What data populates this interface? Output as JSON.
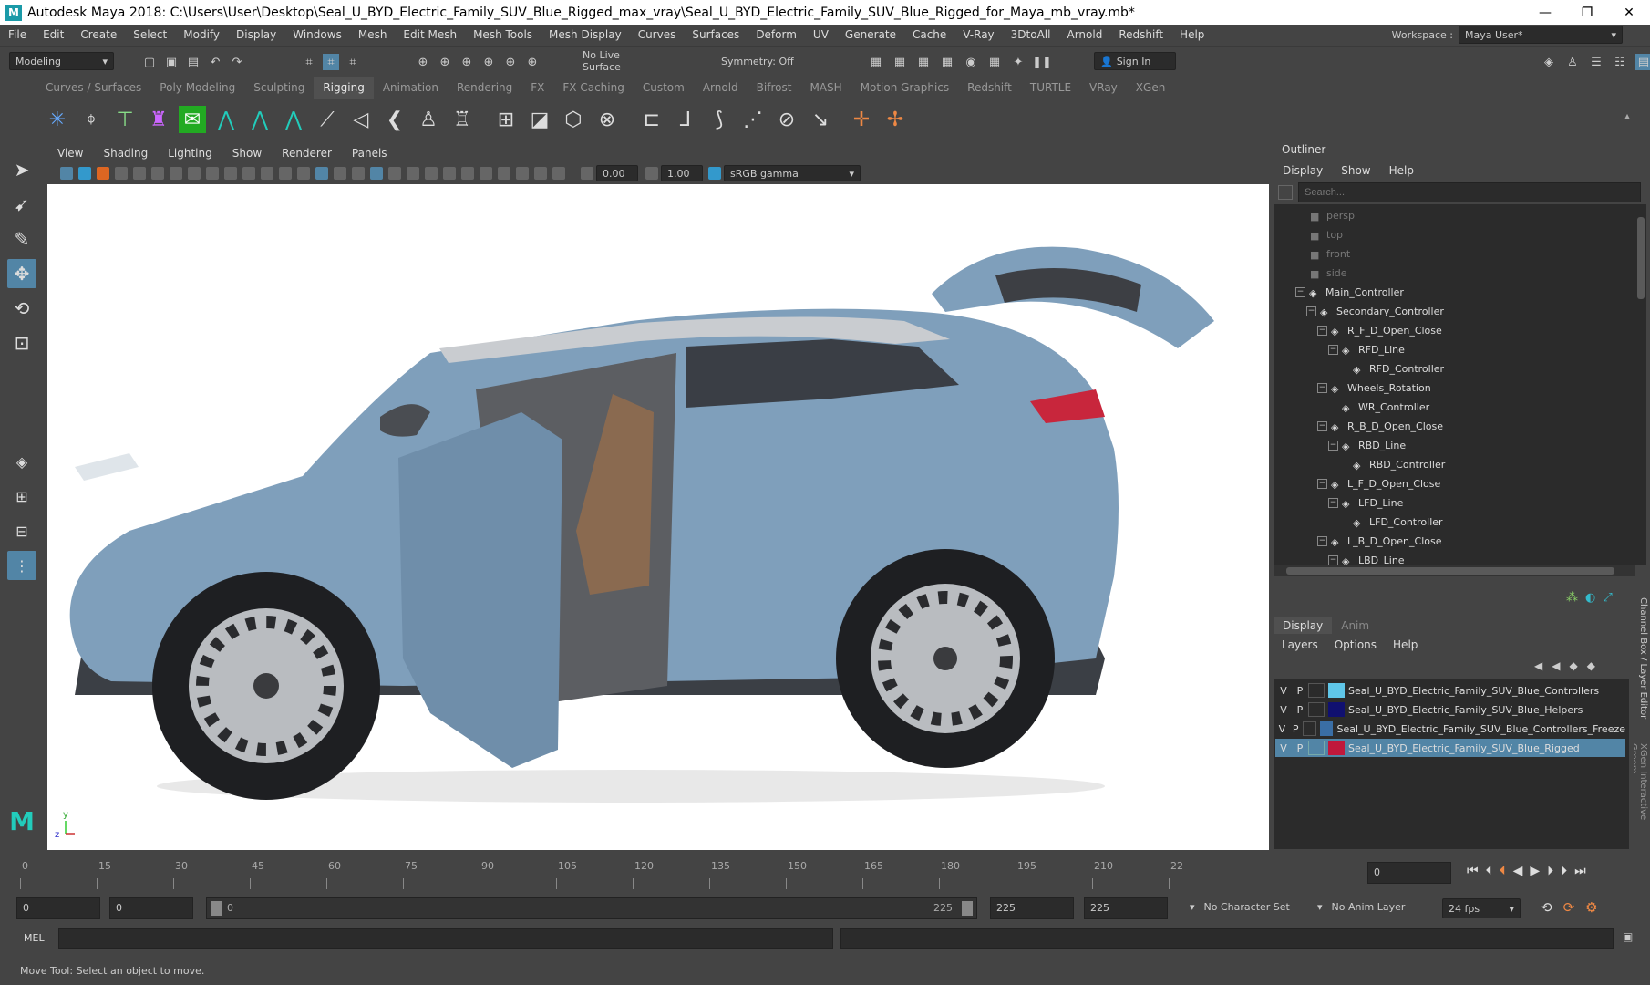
{
  "window": {
    "title": "Autodesk Maya 2018: C:\\Users\\User\\Desktop\\Seal_U_BYD_Electric_Family_SUV_Blue_Rigged_max_vray\\Seal_U_BYD_Electric_Family_SUV_Blue_Rigged_for_Maya_mb_vray.mb*",
    "logo": "M",
    "controls": [
      "—",
      "❐",
      "✕"
    ]
  },
  "menubar": [
    "File",
    "Edit",
    "Create",
    "Select",
    "Modify",
    "Display",
    "Windows",
    "Mesh",
    "Edit Mesh",
    "Mesh Tools",
    "Mesh Display",
    "Curves",
    "Surfaces",
    "Deform",
    "UV",
    "Generate",
    "Cache",
    "V-Ray",
    "3DtoAll",
    "Arnold",
    "Redshift",
    "Help"
  ],
  "workspace": {
    "label": "Workspace :",
    "value": "Maya User*"
  },
  "toolbar": {
    "mode": "Modeling",
    "live_surface": "No Live Surface",
    "symmetry": "Symmetry: Off",
    "sign_in": "Sign In"
  },
  "shelf_tabs": [
    "Curves / Surfaces",
    "Poly Modeling",
    "Sculpting",
    "Rigging",
    "Animation",
    "Rendering",
    "FX",
    "FX Caching",
    "Custom",
    "Arnold",
    "Bifrost",
    "MASH",
    "Motion Graphics",
    "Redshift",
    "TURTLE",
    "VRay",
    "XGen"
  ],
  "shelf_active": "Rigging",
  "viewport": {
    "menu": [
      "View",
      "Shading",
      "Lighting",
      "Show",
      "Renderer",
      "Panels"
    ],
    "exposure": "0.00",
    "gamma": "1.00",
    "color_space": "sRGB gamma",
    "axis_y": "y",
    "axis_z": "z",
    "car_color": "#7f9fbb"
  },
  "outliner": {
    "title": "Outliner",
    "menu": [
      "Display",
      "Show",
      "Help"
    ],
    "search_placeholder": "Search...",
    "items": [
      {
        "label": "persp",
        "dim": true
      },
      {
        "label": "top",
        "dim": true
      },
      {
        "label": "front",
        "dim": true
      },
      {
        "label": "side",
        "dim": true
      },
      {
        "label": "Main_Controller"
      },
      {
        "label": "Secondary_Controller"
      },
      {
        "label": "R_F_D_Open_Close"
      },
      {
        "label": "RFD_Line"
      },
      {
        "label": "RFD_Controller"
      },
      {
        "label": "Wheels_Rotation"
      },
      {
        "label": "WR_Controller"
      },
      {
        "label": "R_B_D_Open_Close"
      },
      {
        "label": "RBD_Line"
      },
      {
        "label": "RBD_Controller"
      },
      {
        "label": "L_F_D_Open_Close"
      },
      {
        "label": "LFD_Line"
      },
      {
        "label": "LFD_Controller"
      },
      {
        "label": "L_B_D_Open_Close"
      },
      {
        "label": "LBD_Line"
      }
    ]
  },
  "channel_box": {
    "tabs": [
      "Display",
      "Anim"
    ],
    "menu": [
      "Layers",
      "Options",
      "Help"
    ],
    "side_tabs": [
      "Channel Box / Layer Editor",
      "XGen Interactive Groom"
    ],
    "layers": [
      {
        "v": "V",
        "p": "P",
        "color": "#5fc6e8",
        "name": "Seal_U_BYD_Electric_Family_SUV_Blue_Controllers"
      },
      {
        "v": "V",
        "p": "P",
        "color": "#101070",
        "name": "Seal_U_BYD_Electric_Family_SUV_Blue_Helpers"
      },
      {
        "v": "V",
        "p": "P",
        "color": "#3a6ea5",
        "name": "Seal_U_BYD_Electric_Family_SUV_Blue_Controllers_Freeze"
      },
      {
        "v": "V",
        "p": "P",
        "color": "#c0183c",
        "name": "Seal_U_BYD_Electric_Family_SUV_Blue_Rigged"
      }
    ]
  },
  "timeline": {
    "ticks": [
      "0",
      "15",
      "30",
      "45",
      "60",
      "75",
      "90",
      "105",
      "120",
      "135",
      "150",
      "165",
      "180",
      "195",
      "210",
      "22"
    ],
    "current_frame": "0"
  },
  "range": {
    "start": "0",
    "anim_start": "0",
    "slider_start": "0",
    "slider_end": "225",
    "end": "225",
    "anim_end": "225",
    "character_set": "No Character Set",
    "anim_layer": "No Anim Layer",
    "fps": "24 fps"
  },
  "mel": {
    "label": "MEL"
  },
  "status": "Move Tool: Select an object to move."
}
